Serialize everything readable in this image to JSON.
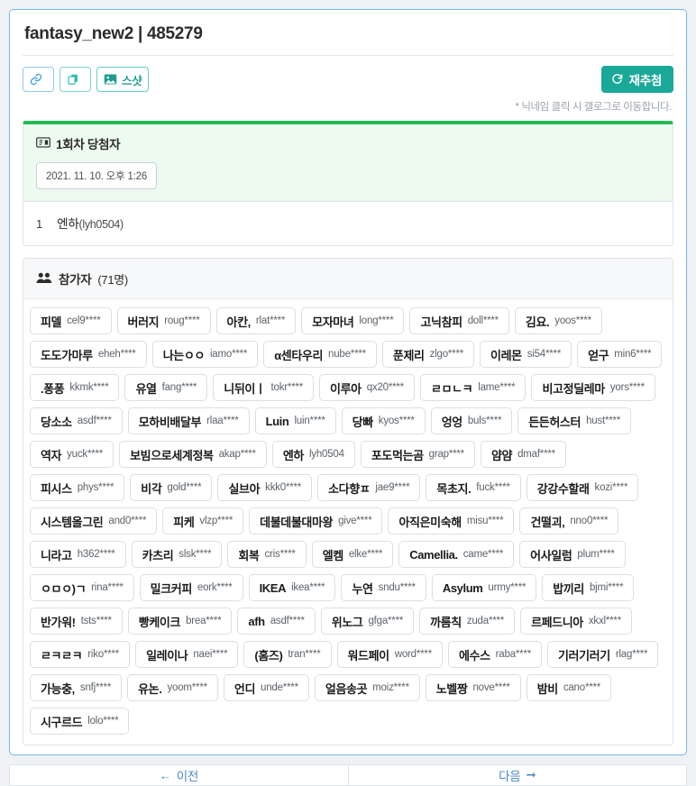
{
  "card": {
    "title": "fantasy_new2 | 485279",
    "hint": "* 닉네임 클릭 시 갤로그로 이동합니다."
  },
  "toolbar": {
    "link_label": "",
    "copy_label": "",
    "snapshot_label": "스샷",
    "refresh_label": "재추첨"
  },
  "winner": {
    "title": "1회차 당첨자",
    "date": "2021. 11. 10. 오후 1:26",
    "rank": "1",
    "nick": "엔하",
    "uid": "(lyh0504)"
  },
  "participants": {
    "title": "참가자",
    "count": "(71명)",
    "list": [
      {
        "nick": "피델",
        "uid": "cel9****"
      },
      {
        "nick": "버러지",
        "uid": "roug****"
      },
      {
        "nick": "아칸,",
        "uid": "rlat****"
      },
      {
        "nick": "모자마녀",
        "uid": "long****"
      },
      {
        "nick": "고닉참피",
        "uid": "doll****"
      },
      {
        "nick": "김요.",
        "uid": "yoos****"
      },
      {
        "nick": "도도가마루",
        "uid": "eheh****"
      },
      {
        "nick": "나는ㅇㅇ",
        "uid": "iamo****"
      },
      {
        "nick": "α센타우리",
        "uid": "nube****"
      },
      {
        "nick": "푼제리",
        "uid": "zlgo****"
      },
      {
        "nick": "이레몬",
        "uid": "si54****"
      },
      {
        "nick": "얻구",
        "uid": "min6****"
      },
      {
        "nick": ".퐁퐁",
        "uid": "kkmk****"
      },
      {
        "nick": "유열",
        "uid": "fang****"
      },
      {
        "nick": "니뒤이ㅣ",
        "uid": "tokr****"
      },
      {
        "nick": "이루아",
        "uid": "qx20****"
      },
      {
        "nick": "ㄹㅁㄴㅋ",
        "uid": "lame****"
      },
      {
        "nick": "비고정딜레마",
        "uid": "yors****"
      },
      {
        "nick": "당소소",
        "uid": "asdf****"
      },
      {
        "nick": "모하비배달부",
        "uid": "rlaa****"
      },
      {
        "nick": "Luin",
        "uid": "luin****"
      },
      {
        "nick": "당빠",
        "uid": "kyos****"
      },
      {
        "nick": "엉엉",
        "uid": "buls****"
      },
      {
        "nick": "든든허스터",
        "uid": "hust****"
      },
      {
        "nick": "역자",
        "uid": "yuck****"
      },
      {
        "nick": "보빔으로세계정복",
        "uid": "akap****"
      },
      {
        "nick": "엔하",
        "uid": "lyh0504"
      },
      {
        "nick": "포도먹는곰",
        "uid": "grap****"
      },
      {
        "nick": "얌얌",
        "uid": "dmaf****"
      },
      {
        "nick": "피시스",
        "uid": "phys****"
      },
      {
        "nick": "비각",
        "uid": "gold****"
      },
      {
        "nick": "실브아",
        "uid": "kkk0****"
      },
      {
        "nick": "소다향ㅍ",
        "uid": "jae9****"
      },
      {
        "nick": "목초지.",
        "uid": "fuck****"
      },
      {
        "nick": "강강수할래",
        "uid": "kozi****"
      },
      {
        "nick": "시스템올그린",
        "uid": "and0****"
      },
      {
        "nick": "피케",
        "uid": "vlzp****"
      },
      {
        "nick": "데불데불대마왕",
        "uid": "give****"
      },
      {
        "nick": "아직은미숙해",
        "uid": "misu****"
      },
      {
        "nick": "건떨괴,",
        "uid": "nno0****"
      },
      {
        "nick": "니라고",
        "uid": "h362****"
      },
      {
        "nick": "카츠리",
        "uid": "slsk****"
      },
      {
        "nick": "회복",
        "uid": "cris****"
      },
      {
        "nick": "엘켐",
        "uid": "elke****"
      },
      {
        "nick": "Camellia.",
        "uid": "came****"
      },
      {
        "nick": "어사일럼",
        "uid": "plum****"
      },
      {
        "nick": "ㅇㅁㅇ)ㄱ",
        "uid": "rina****"
      },
      {
        "nick": "밀크커피",
        "uid": "eork****"
      },
      {
        "nick": "IKEA",
        "uid": "ikea****"
      },
      {
        "nick": "누연",
        "uid": "sndu****"
      },
      {
        "nick": "Asylum",
        "uid": "urmy****"
      },
      {
        "nick": "밥끼리",
        "uid": "bjmi****"
      },
      {
        "nick": "반가워!",
        "uid": "tsts****"
      },
      {
        "nick": "빵케이크",
        "uid": "brea****"
      },
      {
        "nick": "afh",
        "uid": "asdf****"
      },
      {
        "nick": "위노그",
        "uid": "gfga****"
      },
      {
        "nick": "까름칙",
        "uid": "zuda****"
      },
      {
        "nick": "르페드니아",
        "uid": "xkxl****"
      },
      {
        "nick": "ㄹㅋㄹㅋ",
        "uid": "riko****"
      },
      {
        "nick": "일레이나",
        "uid": "naei****"
      },
      {
        "nick": "(홈즈)",
        "uid": "tran****"
      },
      {
        "nick": "워드페이",
        "uid": "word****"
      },
      {
        "nick": "에수스",
        "uid": "raba****"
      },
      {
        "nick": "기러기러기",
        "uid": "rlag****"
      },
      {
        "nick": "가능충,",
        "uid": "snfj****"
      },
      {
        "nick": "유논.",
        "uid": "yoom****"
      },
      {
        "nick": "언디",
        "uid": "unde****"
      },
      {
        "nick": "얼음송곳",
        "uid": "moiz****"
      },
      {
        "nick": "노벨짱",
        "uid": "nove****"
      },
      {
        "nick": "밤비",
        "uid": "cano****"
      },
      {
        "nick": "시구르드",
        "uid": "lolo****"
      }
    ]
  },
  "pager": {
    "prev": "이전",
    "next": "다음"
  },
  "colors": {
    "accent_teal": "#1aa898",
    "accent_blue": "#3b9de0",
    "winner_green": "#22bb55",
    "winner_bg": "#ecfaef",
    "pager_link": "#4a86c8"
  }
}
